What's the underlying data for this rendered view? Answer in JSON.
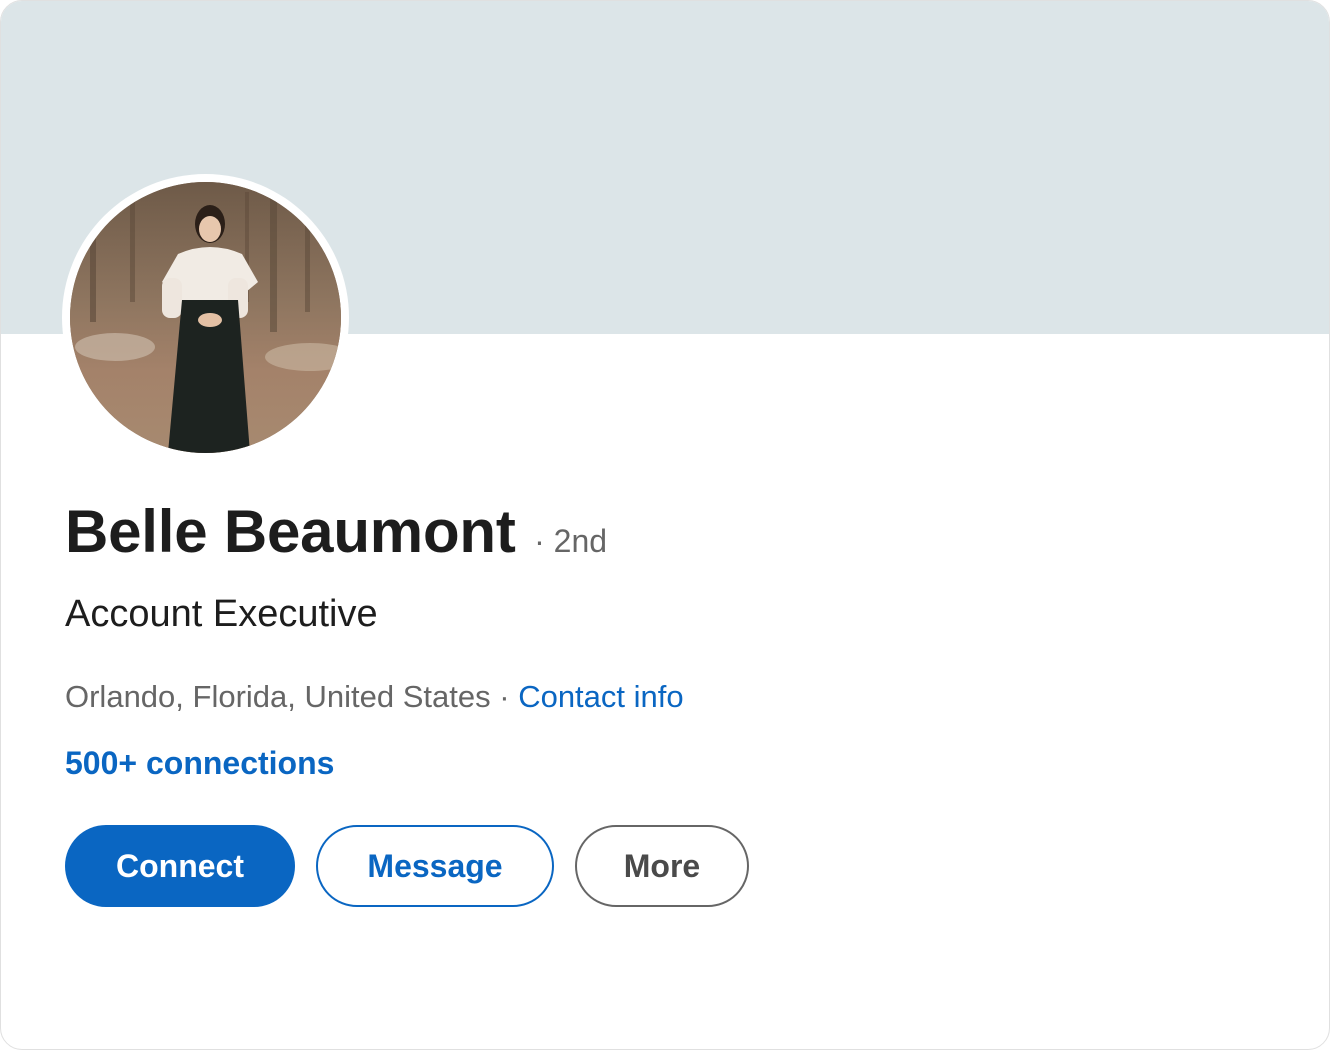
{
  "profile": {
    "name": "Belle Beaumont",
    "degree": "· 2nd",
    "headline": "Account Executive",
    "location": "Orlando, Florida, United States",
    "separator": "·",
    "contact_info_label": "Contact info",
    "connections_label": "500+ connections"
  },
  "actions": {
    "connect_label": "Connect",
    "message_label": "Message",
    "more_label": "More"
  },
  "colors": {
    "accent": "#0a66c2",
    "banner": "#dce5e8",
    "text_primary": "#1d1d1d",
    "text_secondary": "#666666"
  }
}
